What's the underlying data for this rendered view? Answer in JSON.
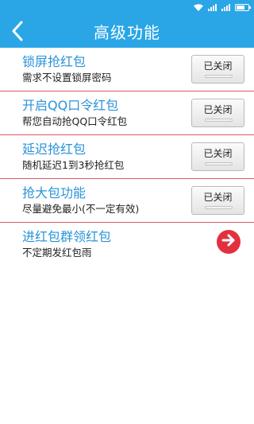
{
  "status_bar": {
    "icons": [
      "wifi-icon",
      "signal-icon",
      "signal-icon",
      "battery-icon"
    ]
  },
  "header": {
    "title": "高级功能",
    "back_icon": "back-icon",
    "background": "#2aa6e6"
  },
  "settings": [
    {
      "title": "锁屏抢红包",
      "desc": "需求不设置锁屏密码",
      "control": "toggle",
      "state": "已关闭"
    },
    {
      "title": "开启QQ口令红包",
      "desc": "帮您自动抢QQ口令红包",
      "control": "toggle",
      "state": "已关闭"
    },
    {
      "title": "延迟抢红包",
      "desc": "随机延迟1到3秒抢红包",
      "control": "toggle",
      "state": "已关闭"
    },
    {
      "title": "抢大包功能",
      "desc": "尽量避免最小(不一定有效)",
      "control": "toggle",
      "state": "已关闭"
    },
    {
      "title": "进红包群领红包",
      "desc": "不定期发红包雨",
      "control": "arrow",
      "icon": "arrow-right-icon"
    }
  ],
  "colors": {
    "accent": "#2aa6e6",
    "title_text": "#2a93d8",
    "divider": "#e0566a",
    "arrow_button": "#e1313f"
  }
}
